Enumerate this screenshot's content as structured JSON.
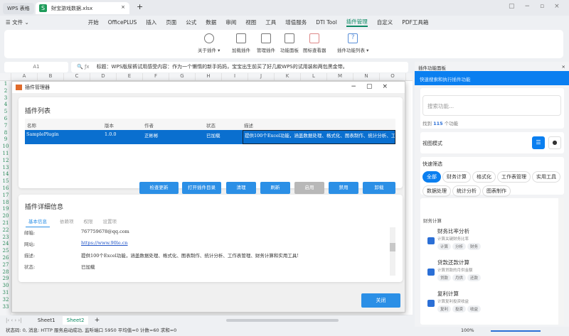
{
  "titlebar": {
    "app": "WPS 表格",
    "file": "財宝游戏数据.xlsx",
    "new_tab": "+"
  },
  "menu": {
    "items": [
      "☰ 文件 ⌄",
      "开始",
      "OfficePLUS",
      "插入",
      "页面",
      "公式",
      "数据",
      "审阅",
      "视图",
      "工具",
      "增值服务",
      "DTI Tool",
      "插件管理",
      "自定义",
      "PDF工具箱"
    ],
    "active": "插件管理"
  },
  "ribbon": {
    "buttons": [
      "关于插件 ▾",
      "加载插件",
      "管理插件",
      "功能面板",
      "图标查看器",
      "插件功能列表 ▾"
    ]
  },
  "formula": {
    "cell": "A1",
    "content": "标题：WPS版尿裤试用感受内容：作为一个懒惰的新手妈妈，宝宝出生前买了好几款WPS的试用装和两包黑金带。"
  },
  "columns": [
    "A",
    "B",
    "C",
    "D",
    "E",
    "F",
    "G",
    "H",
    "I",
    "J",
    "K",
    "L",
    "M",
    "N",
    "O"
  ],
  "dialog": {
    "title": "插件管理器",
    "list_title": "插件列表",
    "headers": [
      "名称",
      "版本",
      "作者",
      "状态",
      "描述"
    ],
    "row": [
      "SamplePlugin",
      "1.0.0",
      "正彬彬",
      "已加载",
      "提供100个Excel功能，涵盖数据处理、格式化、图表制作、统计分析、工"
    ],
    "buttons": [
      "检查更新",
      "打开插件目录",
      "清理",
      "刷新",
      "启用",
      "禁用",
      "卸载"
    ],
    "detail_title": "插件详细信息",
    "tabs": [
      "基本信息",
      "依赖项",
      "权限",
      "设置项"
    ],
    "fields": [
      {
        "label": "邮箱:",
        "value": "767759678@qq.com"
      },
      {
        "label": "网站:",
        "value": "https://www.90le.cn"
      },
      {
        "label": "描述:",
        "value": "提供100个Excel功能，涵盖数据处理、格式化、图表制作、统计分析、工作表管理、财务计算和实用工具!"
      },
      {
        "label": "状态:",
        "value": "已加载"
      }
    ],
    "close": "关闭"
  },
  "sheets": [
    "Sheet1",
    "Sheet2"
  ],
  "active_sheet": "Sheet2",
  "status": "状态码: 0, 消息: HTTP 服务启动成功, 监听端口 5950   平均值=0   计数=60   求和=0",
  "zoom": "100%",
  "side": {
    "title": "插件功能面板",
    "banner": "快速搜索和执行插件功能",
    "search_placeholder": "搜索功能...",
    "found_prefix": "找到",
    "found_count": "115",
    "found_suffix": "个功能",
    "view_mode": "视图模式",
    "filter_title": "快速筛选",
    "chips": [
      "全部",
      "财务计算",
      "格式化",
      "工作表管理",
      "实用工具",
      "数据处理",
      "统计分析",
      "图表制作"
    ],
    "section": "财务计算",
    "items": [
      {
        "title": "财务比率分析",
        "desc": "计算关键财务比率",
        "tags": [
          "计算",
          "分析",
          "财务"
        ]
      },
      {
        "title": "贷款还款计算",
        "desc": "计算贷款的月供金额",
        "tags": [
          "贷款",
          "月供",
          "还款"
        ]
      },
      {
        "title": "复利计算",
        "desc": "计算复利投资收益",
        "tags": [
          "复利",
          "投资",
          "收益"
        ]
      }
    ]
  },
  "colors": {
    "accent": "#2b8fe6",
    "selection": "#0a6fcf",
    "green": "#0d8a64"
  }
}
